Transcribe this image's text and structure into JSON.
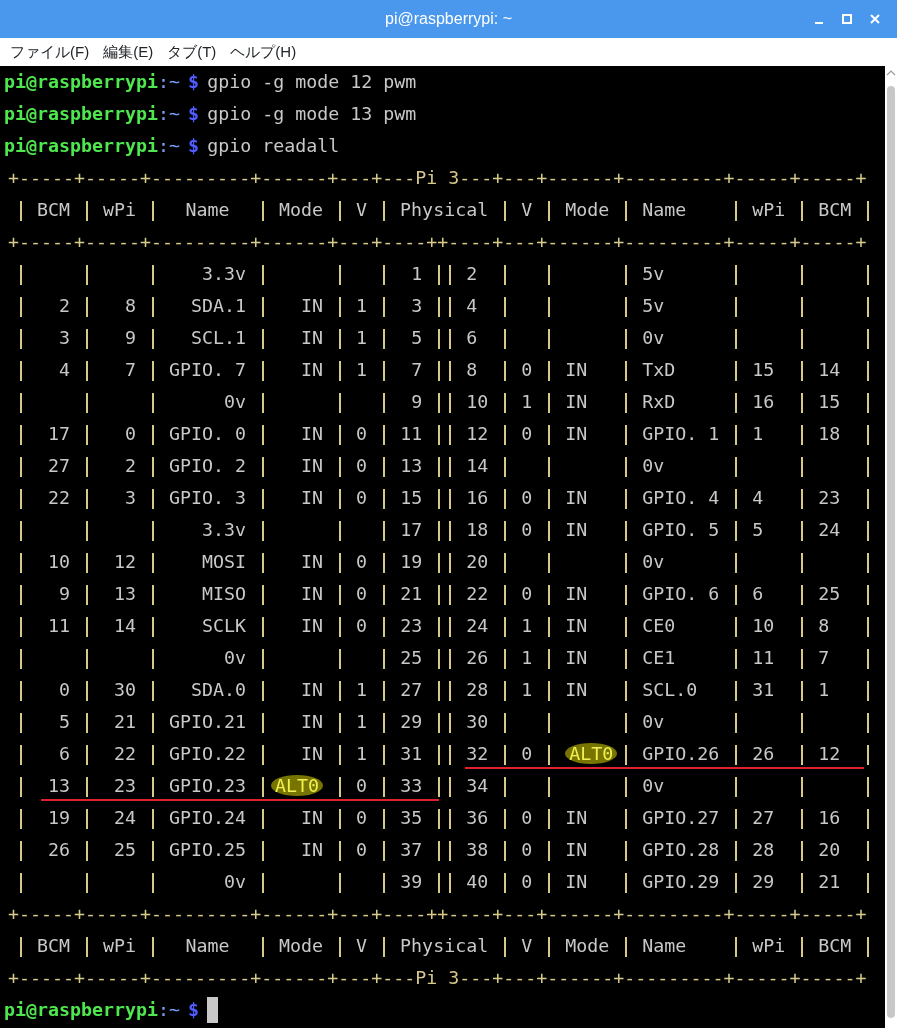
{
  "window": {
    "title": "pi@raspberrypi: ~"
  },
  "menu": [
    "ファイル(F)",
    "編集(E)",
    "タブ(T)",
    "ヘルプ(H)"
  ],
  "terminal": {
    "lines": [
      {
        "kind": "prompt",
        "user": "pi@raspberrypi",
        "path": ":~",
        "symbol": "$",
        "command": "gpio -g mode 12 pwm"
      },
      {
        "kind": "prompt",
        "user": "pi@raspberrypi",
        "path": ":~",
        "symbol": "$",
        "command": "gpio -g mode 13 pwm"
      },
      {
        "kind": "prompt",
        "user": "pi@raspberrypi",
        "path": ":~",
        "symbol": "$",
        "command": "gpio readall"
      },
      {
        "kind": "rule",
        "text": "+-----+-----+---------+------+---+---Pi 3---+---+------+---------+-----+-----+"
      },
      {
        "kind": "header",
        "cells": [
          "BCM",
          "wPi",
          "Name",
          "Mode",
          "V",
          "Physical",
          "V",
          "Mode",
          "Name",
          "wPi",
          "BCM"
        ]
      },
      {
        "kind": "rule",
        "text": "+-----+-----+---------+------+---+----++----+---+------+---------+-----+-----+"
      },
      {
        "kind": "row",
        "left_marked": false,
        "right_marked": false,
        "cells": [
          null,
          null,
          "3.3v",
          null,
          null,
          "1",
          "2",
          null,
          null,
          "5v",
          null,
          null
        ]
      },
      {
        "kind": "row",
        "left_marked": false,
        "right_marked": false,
        "cells": [
          "2",
          "8",
          "SDA.1",
          "IN",
          "1",
          "3",
          "4",
          null,
          null,
          "5v",
          null,
          null
        ]
      },
      {
        "kind": "row",
        "left_marked": false,
        "right_marked": false,
        "cells": [
          "3",
          "9",
          "SCL.1",
          "IN",
          "1",
          "5",
          "6",
          null,
          null,
          "0v",
          null,
          null
        ]
      },
      {
        "kind": "row",
        "left_marked": false,
        "right_marked": false,
        "cells": [
          "4",
          "7",
          "GPIO. 7",
          "IN",
          "1",
          "7",
          "8",
          "0",
          "IN",
          "TxD",
          "15",
          "14"
        ]
      },
      {
        "kind": "row",
        "left_marked": false,
        "right_marked": false,
        "cells": [
          null,
          null,
          "0v",
          null,
          null,
          "9",
          "10",
          "1",
          "IN",
          "RxD",
          "16",
          "15"
        ]
      },
      {
        "kind": "row",
        "left_marked": false,
        "right_marked": false,
        "cells": [
          "17",
          "0",
          "GPIO. 0",
          "IN",
          "0",
          "11",
          "12",
          "0",
          "IN",
          "GPIO. 1",
          "1",
          "18"
        ]
      },
      {
        "kind": "row",
        "left_marked": false,
        "right_marked": false,
        "cells": [
          "27",
          "2",
          "GPIO. 2",
          "IN",
          "0",
          "13",
          "14",
          null,
          null,
          "0v",
          null,
          null
        ]
      },
      {
        "kind": "row",
        "left_marked": false,
        "right_marked": false,
        "cells": [
          "22",
          "3",
          "GPIO. 3",
          "IN",
          "0",
          "15",
          "16",
          "0",
          "IN",
          "GPIO. 4",
          "4",
          "23"
        ]
      },
      {
        "kind": "row",
        "left_marked": false,
        "right_marked": false,
        "cells": [
          null,
          null,
          "3.3v",
          null,
          null,
          "17",
          "18",
          "0",
          "IN",
          "GPIO. 5",
          "5",
          "24"
        ]
      },
      {
        "kind": "row",
        "left_marked": false,
        "right_marked": false,
        "cells": [
          "10",
          "12",
          "MOSI",
          "IN",
          "0",
          "19",
          "20",
          null,
          null,
          "0v",
          null,
          null
        ]
      },
      {
        "kind": "row",
        "left_marked": false,
        "right_marked": false,
        "cells": [
          "9",
          "13",
          "MISO",
          "IN",
          "0",
          "21",
          "22",
          "0",
          "IN",
          "GPIO. 6",
          "6",
          "25"
        ]
      },
      {
        "kind": "row",
        "left_marked": false,
        "right_marked": false,
        "cells": [
          "11",
          "14",
          "SCLK",
          "IN",
          "0",
          "23",
          "24",
          "1",
          "IN",
          "CE0",
          "10",
          "8"
        ]
      },
      {
        "kind": "row",
        "left_marked": false,
        "right_marked": false,
        "cells": [
          null,
          null,
          "0v",
          null,
          null,
          "25",
          "26",
          "1",
          "IN",
          "CE1",
          "11",
          "7"
        ]
      },
      {
        "kind": "row",
        "left_marked": false,
        "right_marked": false,
        "cells": [
          "0",
          "30",
          "SDA.0",
          "IN",
          "1",
          "27",
          "28",
          "1",
          "IN",
          "SCL.0",
          "31",
          "1"
        ]
      },
      {
        "kind": "row",
        "left_marked": false,
        "right_marked": false,
        "cells": [
          "5",
          "21",
          "GPIO.21",
          "IN",
          "1",
          "29",
          "30",
          null,
          null,
          "0v",
          null,
          null
        ]
      },
      {
        "kind": "row",
        "left_marked": false,
        "right_marked": true,
        "cells": [
          "6",
          "22",
          "GPIO.22",
          "IN",
          "1",
          "31",
          "32",
          "0",
          "ALT0",
          "GPIO.26",
          "26",
          "12"
        ]
      },
      {
        "kind": "row",
        "left_marked": true,
        "right_marked": false,
        "cells": [
          "13",
          "23",
          "GPIO.23",
          "ALT0",
          "0",
          "33",
          "34",
          null,
          null,
          "0v",
          null,
          null
        ]
      },
      {
        "kind": "row",
        "left_marked": false,
        "right_marked": false,
        "cells": [
          "19",
          "24",
          "GPIO.24",
          "IN",
          "0",
          "35",
          "36",
          "0",
          "IN",
          "GPIO.27",
          "27",
          "16"
        ]
      },
      {
        "kind": "row",
        "left_marked": false,
        "right_marked": false,
        "cells": [
          "26",
          "25",
          "GPIO.25",
          "IN",
          "0",
          "37",
          "38",
          "0",
          "IN",
          "GPIO.28",
          "28",
          "20"
        ]
      },
      {
        "kind": "row",
        "left_marked": false,
        "right_marked": false,
        "cells": [
          null,
          null,
          "0v",
          null,
          null,
          "39",
          "40",
          "0",
          "IN",
          "GPIO.29",
          "29",
          "21"
        ]
      },
      {
        "kind": "rule",
        "text": "+-----+-----+---------+------+---+----++----+---+------+---------+-----+-----+"
      },
      {
        "kind": "header",
        "cells": [
          "BCM",
          "wPi",
          "Name",
          "Mode",
          "V",
          "Physical",
          "V",
          "Mode",
          "Name",
          "wPi",
          "BCM"
        ]
      },
      {
        "kind": "rule",
        "text": "+-----+-----+---------+------+---+---Pi 3---+---+------+---------+-----+-----+"
      },
      {
        "kind": "prompt",
        "user": "pi@raspberrypi",
        "path": ":~",
        "symbol": "$",
        "cursor": true
      }
    ]
  }
}
